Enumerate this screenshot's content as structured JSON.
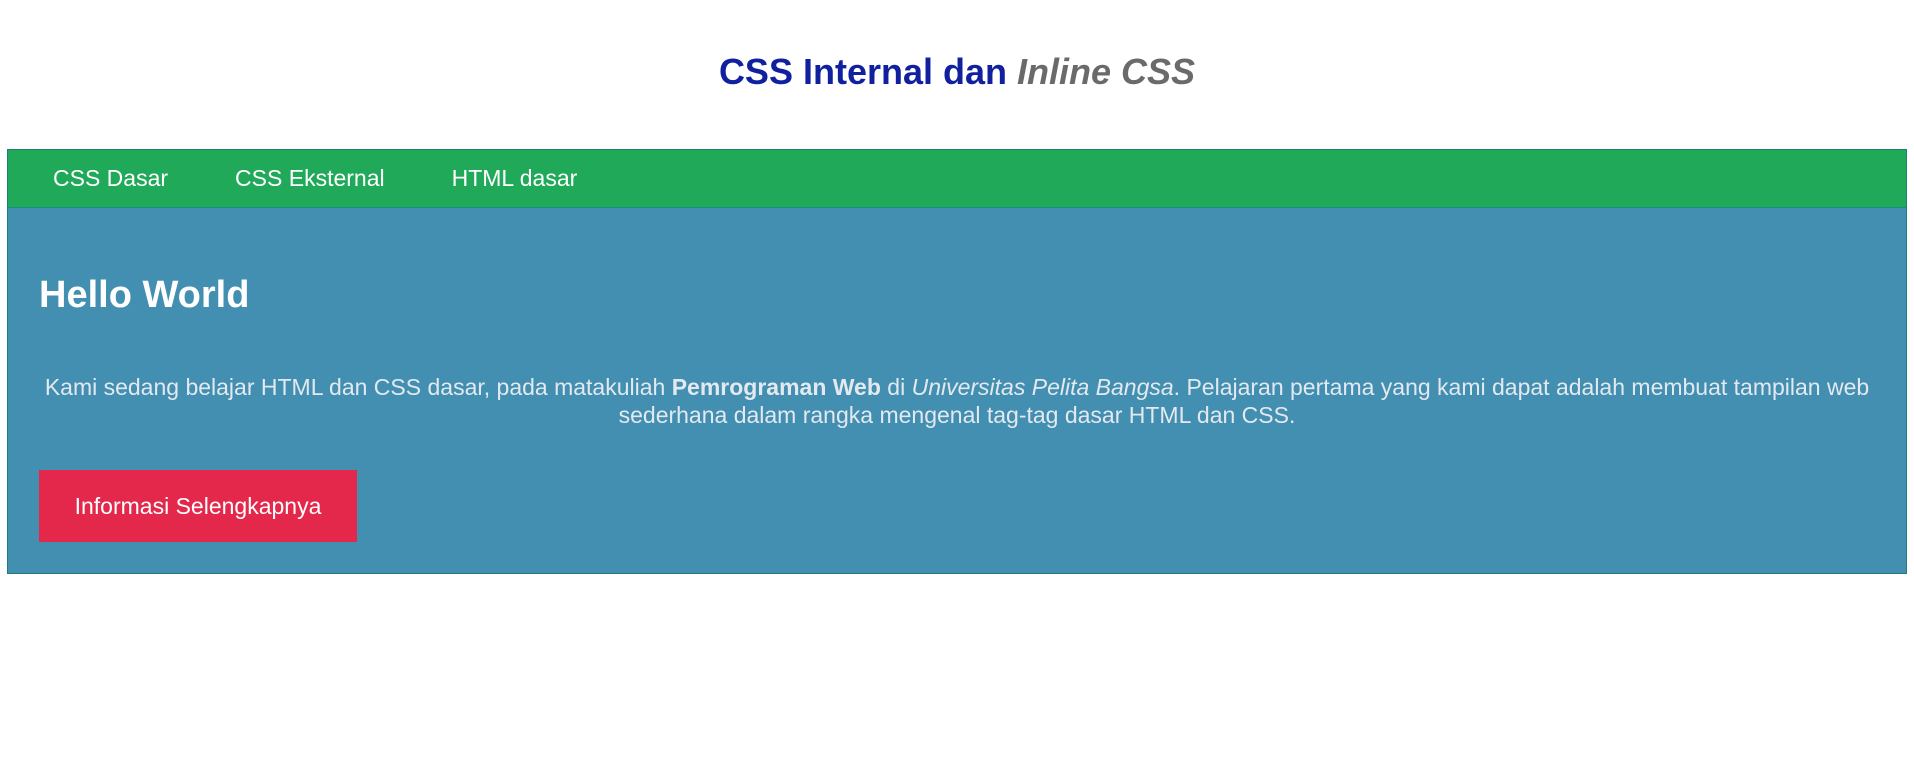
{
  "header": {
    "title_main": "CSS Internal dan",
    "title_alt": "Inline CSS"
  },
  "nav": {
    "items": [
      {
        "label": "CSS Dasar"
      },
      {
        "label": "CSS Eksternal"
      },
      {
        "label": "HTML dasar"
      }
    ]
  },
  "hero": {
    "heading": "Hello World",
    "paragraph": {
      "part1": "Kami sedang belajar HTML dan CSS dasar, pada matakuliah ",
      "bold": "Pemrograman Web",
      "part2": " di ",
      "italic": "Universitas Pelita Bangsa",
      "part3": ". Pelajaran pertama yang kami dapat adalah membuat tampilan web sederhana dalam rangka mengenal tag-tag dasar HTML dan CSS."
    },
    "button_label": "Informasi Selengkapnya"
  },
  "colors": {
    "title_blue": "#10209e",
    "title_gray": "#6a6a6a",
    "nav_green": "#21a95a",
    "hero_blue": "#428fb2",
    "button_red": "#e3284b"
  }
}
